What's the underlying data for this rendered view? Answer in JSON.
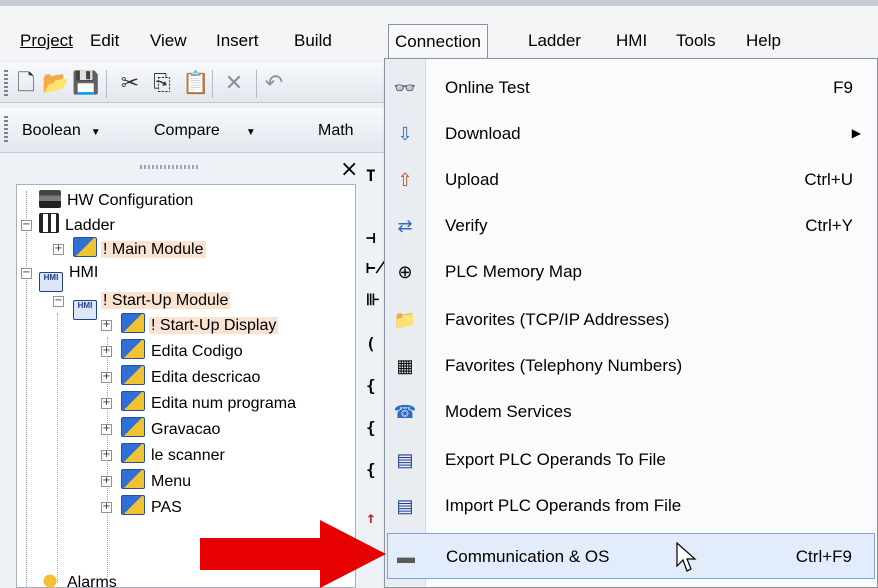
{
  "menubar": {
    "items": [
      "Project",
      "Edit",
      "View",
      "Insert",
      "Build",
      "Connection",
      "Ladder",
      "HMI",
      "Tools",
      "Help"
    ],
    "active": "Connection"
  },
  "toolbar2": {
    "dropdowns": [
      "Boolean",
      "Compare",
      "Math"
    ]
  },
  "tree": {
    "nodes": [
      "HW Configuration",
      "Ladder",
      "! Main Module",
      "HMI",
      "! Start-Up Module",
      "! Start-Up Display",
      "Edita Codigo",
      "Edita descricao",
      "Edita num programa",
      "Gravacao",
      "le scanner",
      "Menu",
      "PAS",
      "Alarms"
    ],
    "hmi_icon_text": "HMI"
  },
  "connection_menu": {
    "items": [
      {
        "label": "Online Test",
        "shortcut": "F9",
        "icon": "glasses-icon"
      },
      {
        "label": "Download",
        "shortcut": "",
        "icon": "download-icon",
        "submenu": true
      },
      {
        "label": "Upload",
        "shortcut": "Ctrl+U",
        "icon": "upload-icon"
      },
      {
        "label": "Verify",
        "shortcut": "Ctrl+Y",
        "icon": "verify-icon"
      },
      {
        "label": "PLC Memory Map",
        "shortcut": "",
        "icon": "memory-map-icon"
      },
      {
        "label": "Favorites (TCP/IP Addresses)",
        "shortcut": "",
        "icon": "favorites-folder-icon"
      },
      {
        "label": "Favorites (Telephony Numbers)",
        "shortcut": "",
        "icon": "phonebook-icon"
      },
      {
        "label": "Modem Services",
        "shortcut": "",
        "icon": "modem-icon"
      },
      {
        "label": "Export PLC Operands To File",
        "shortcut": "",
        "icon": "export-table-icon"
      },
      {
        "label": "Import PLC Operands from File",
        "shortcut": "",
        "icon": "import-table-icon"
      },
      {
        "label": "Communication & OS",
        "shortcut": "Ctrl+F9",
        "icon": "communication-icon"
      }
    ],
    "hovered": "Communication & OS"
  },
  "colors": {
    "menu_hover_bg": "#e3ecfa",
    "menu_hover_border": "#7da2e1",
    "tree_highlight": "#fbe3d2",
    "arrow": "#e60000"
  }
}
